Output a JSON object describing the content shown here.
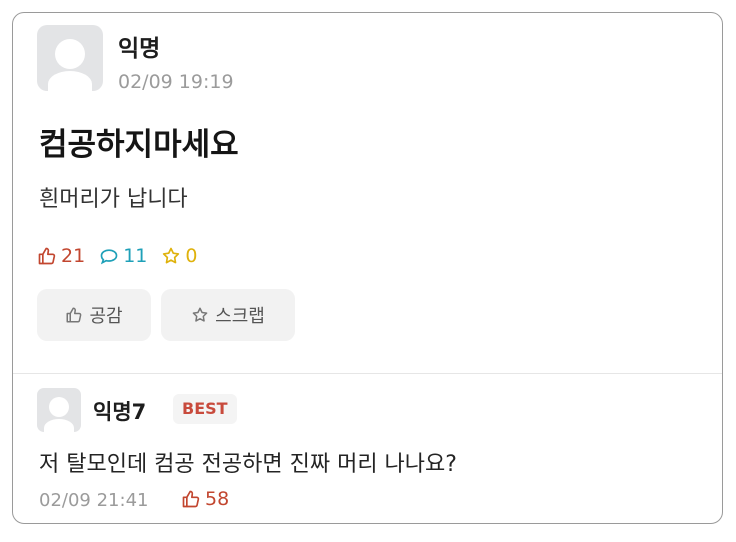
{
  "post": {
    "author": "익명",
    "date": "02/09 19:19",
    "title": "컴공하지마세요",
    "content": "흰머리가 납니다",
    "stats": {
      "likes": "21",
      "comments": "11",
      "scraps": "0"
    },
    "buttons": {
      "empathy": "공감",
      "scrap": "스크랩"
    }
  },
  "comment": {
    "author": "익명7",
    "badge": "BEST",
    "text": "저 탈모인데 컴공 전공하면 진짜 머리 나나요?",
    "date": "02/09 21:41",
    "likes": "58"
  },
  "colors": {
    "like": "#c2462f",
    "comment": "#1ea0b8",
    "scrap": "#dfb20c",
    "best": "#c84a3c"
  }
}
